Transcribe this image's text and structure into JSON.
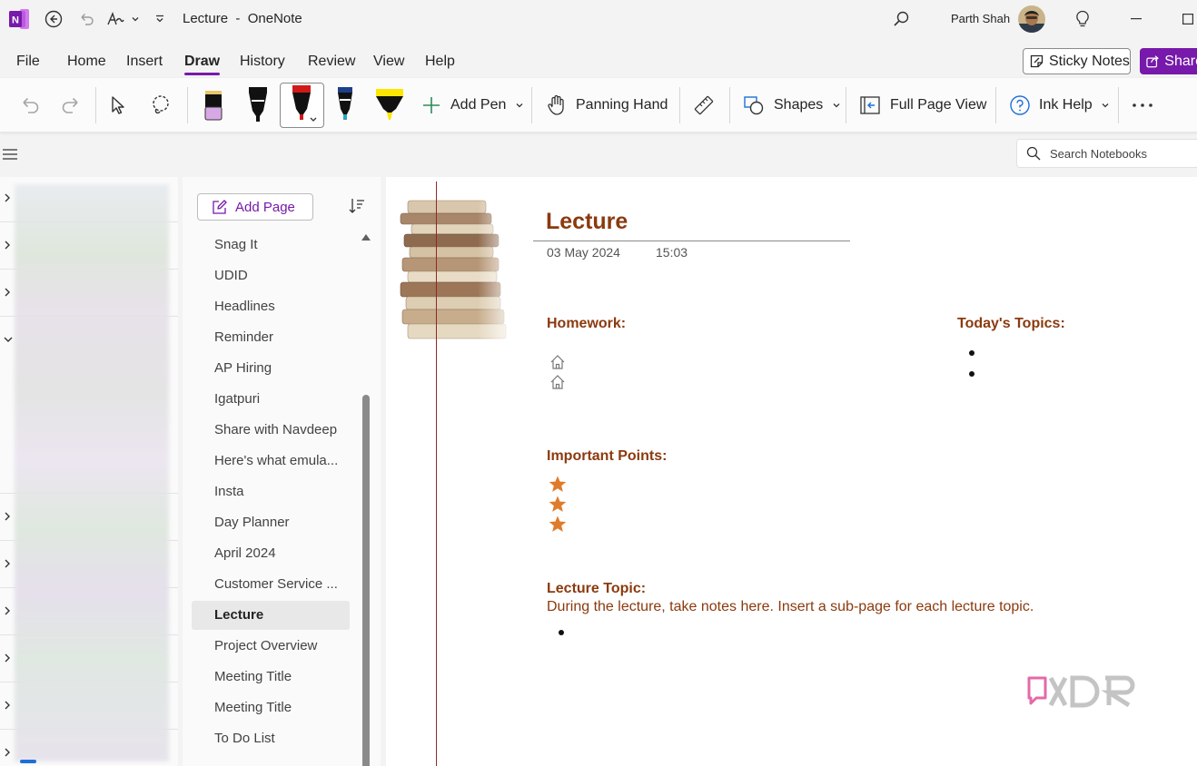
{
  "window": {
    "title": "Lecture",
    "separator": "  -  ",
    "app_name": "OneNote",
    "user_name": "Parth Shah"
  },
  "menu": {
    "tabs": [
      {
        "label": "File"
      },
      {
        "label": "Home"
      },
      {
        "label": "Insert"
      },
      {
        "label": "Draw",
        "active": true
      },
      {
        "label": "History"
      },
      {
        "label": "Review"
      },
      {
        "label": "View"
      },
      {
        "label": "Help"
      }
    ],
    "sticky_notes": "Sticky Notes",
    "share": "Share"
  },
  "ribbon": {
    "add_pen": "Add Pen",
    "panning_hand": "Panning Hand",
    "shapes": "Shapes",
    "full_page_view": "Full Page View",
    "ink_help": "Ink Help"
  },
  "search": {
    "placeholder": "Search Notebooks"
  },
  "pages_panel": {
    "add_page": "Add Page",
    "pages": [
      {
        "title": "Snag It"
      },
      {
        "title": "UDID"
      },
      {
        "title": "Headlines"
      },
      {
        "title": "Reminder"
      },
      {
        "title": "AP Hiring"
      },
      {
        "title": "Igatpuri"
      },
      {
        "title": "Share with Navdeep"
      },
      {
        "title": "Here's what emula..."
      },
      {
        "title": "Insta"
      },
      {
        "title": "Day Planner"
      },
      {
        "title": "April 2024"
      },
      {
        "title": "Customer Service ..."
      },
      {
        "title": "Lecture",
        "selected": true
      },
      {
        "title": "Project Overview"
      },
      {
        "title": "Meeting Title"
      },
      {
        "title": "Meeting Title"
      },
      {
        "title": "To Do List"
      }
    ]
  },
  "page": {
    "title": "Lecture",
    "date": "03 May 2024",
    "time": "15:03",
    "homework_heading": "Homework:",
    "topics_heading": "Today's Topics:",
    "important_heading": "Important Points:",
    "lecture_topic_heading": "Lecture Topic:",
    "lecture_topic_body": "During the lecture, take notes here.  Insert a sub-page for each lecture topic."
  },
  "colors": {
    "accent": "#7719aa",
    "heading": "#8b3a0e",
    "star": "#e07b2a"
  }
}
